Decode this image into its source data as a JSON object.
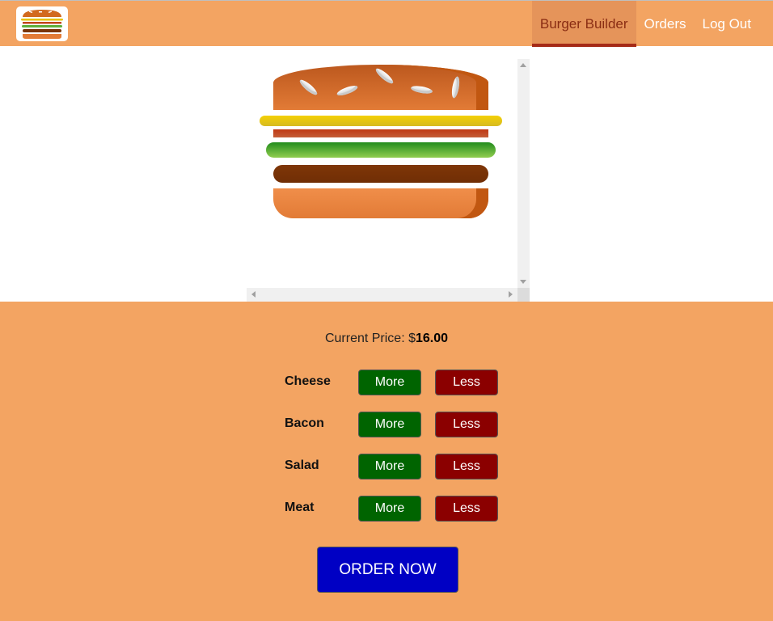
{
  "header": {
    "logo_icon": "burger-logo-icon",
    "nav": [
      {
        "label": "Burger Builder",
        "active": true
      },
      {
        "label": "Orders",
        "active": false
      },
      {
        "label": "Log Out",
        "active": false
      }
    ]
  },
  "burger": {
    "layers": [
      "bread-top",
      "cheese",
      "bacon",
      "salad",
      "meat",
      "bread-bottom"
    ]
  },
  "build_controls": {
    "price_label": "Current Price: $",
    "price_value": "16.00",
    "controls": [
      {
        "label": "Cheese",
        "more": "More",
        "less": "Less"
      },
      {
        "label": "Bacon",
        "more": "More",
        "less": "Less"
      },
      {
        "label": "Salad",
        "more": "More",
        "less": "Less"
      },
      {
        "label": "Meat",
        "more": "More",
        "less": "Less"
      }
    ],
    "order_button": "ORDER NOW"
  },
  "colors": {
    "toolbar_bg": "#f3a462",
    "more_button": "#006400",
    "less_button": "#8b0000",
    "order_button": "#0000c4",
    "active_nav_text": "#8a2d13"
  }
}
